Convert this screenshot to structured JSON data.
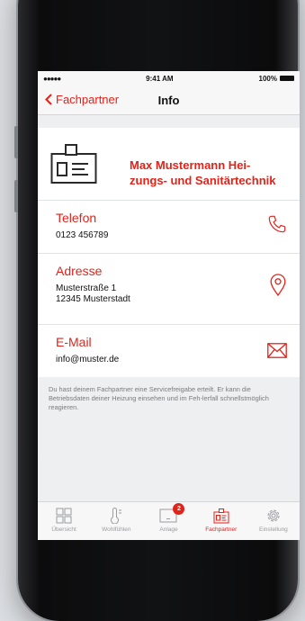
{
  "status_bar": {
    "signal": "●●●●● ",
    "time": "9:41 AM",
    "battery": "100%"
  },
  "nav": {
    "back_label": "Fachpartner",
    "title": "Info"
  },
  "partner": {
    "name": "Max Mustermann Hei-zungs- und Sanitärtechnik",
    "name_line1": "Max Mustermann Hei-",
    "name_line2": "zungs- und Sanitärtechnik"
  },
  "contact": {
    "phone": {
      "label": "Telefon",
      "value": "0123 456789",
      "icon": "phone-icon"
    },
    "address": {
      "label": "Adresse",
      "line1": "Musterstraße 1",
      "line2": "12345 Musterstadt",
      "icon": "location-pin-icon"
    },
    "email": {
      "label": "E-Mail",
      "value": "info@muster.de",
      "icon": "mail-icon"
    }
  },
  "note": "Du hast deinem Fachpartner eine Servicefreigabe erteilt. Er kann die Betriebsdaten deiner Heizung einsehen und im Feh-lerfall schnellstmöglich reagieren.",
  "tabs": [
    {
      "label": "Übersicht",
      "icon": "grid-icon"
    },
    {
      "label": "Wohlfühlen",
      "icon": "thermometer-icon"
    },
    {
      "label": "Anlage",
      "icon": "device-icon",
      "badge": "2"
    },
    {
      "label": "Fachpartner",
      "icon": "id-badge-icon",
      "active": true
    },
    {
      "label": "Einstellung",
      "icon": "gear-icon"
    }
  ],
  "colors": {
    "accent": "#e2231a",
    "text": "#111111",
    "muted": "#7a7b7e",
    "background": "#eeeff1"
  }
}
